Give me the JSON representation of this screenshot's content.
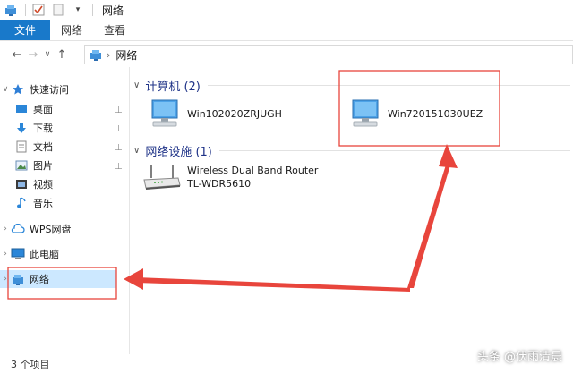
{
  "window": {
    "title": "网络"
  },
  "ribbon": {
    "tabs": [
      "文件",
      "网络",
      "查看"
    ]
  },
  "address": {
    "crumb": "网络"
  },
  "nav": {
    "quick_access": "快速访问",
    "items": [
      "桌面",
      "下载",
      "文档",
      "图片",
      "视频",
      "音乐"
    ],
    "wps": "WPS网盘",
    "this_pc": "此电脑",
    "network": "网络"
  },
  "groups": {
    "computers": "计算机 (2)",
    "infrastructure": "网络设施 (1)"
  },
  "computers": [
    "Win102020ZRJUGH",
    "Win720151030UEZ"
  ],
  "router": {
    "line1": "Wireless Dual Band Router",
    "line2": "TL-WDR5610"
  },
  "status": {
    "items": "3 个项目"
  },
  "watermark": "头条 @伏雨清晨",
  "colors": {
    "accent": "#1979ca",
    "annotation": "#e8453c",
    "selected": "#cce8ff",
    "group_heading": "#1e3287"
  },
  "icons": [
    "network-icon",
    "check-icon",
    "document-icon",
    "star-icon",
    "desktop-icon",
    "download-arrow-icon",
    "document-icon",
    "picture-icon",
    "video-icon",
    "music-note-icon",
    "cloud-icon",
    "computer-icon",
    "router-icon",
    "pin-icon"
  ]
}
